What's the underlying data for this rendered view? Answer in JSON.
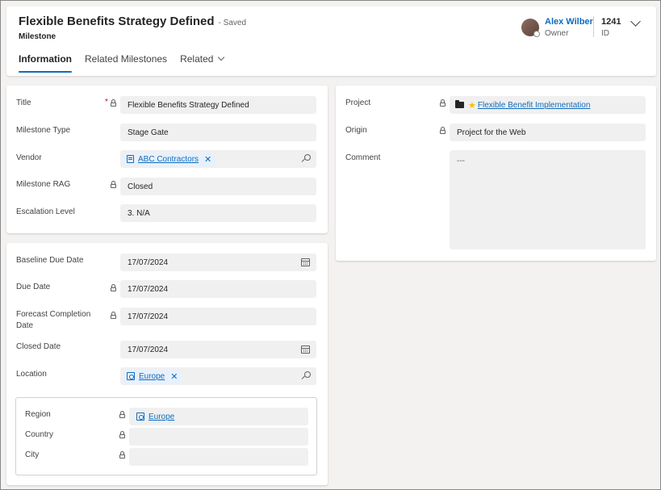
{
  "header": {
    "title": "Flexible Benefits Strategy Defined",
    "saved": "- Saved",
    "entity": "Milestone",
    "owner_name": "Alex Wilber",
    "owner_role": "Owner",
    "id_value": "1241",
    "id_label": "ID",
    "tabs": [
      {
        "label": "Information",
        "active": true
      },
      {
        "label": "Related Milestones",
        "active": false
      },
      {
        "label": "Related",
        "active": false
      }
    ]
  },
  "general": {
    "title_label": "Title",
    "title_required": "*",
    "title_value": "Flexible Benefits Strategy Defined",
    "type_label": "Milestone Type",
    "type_value": "Stage Gate",
    "vendor_label": "Vendor",
    "vendor_value": "ABC Contractors",
    "rag_label": "Milestone RAG",
    "rag_value": "Closed",
    "escalation_label": "Escalation Level",
    "escalation_value": "3. N/A"
  },
  "dates": {
    "baseline_label": "Baseline Due Date",
    "baseline_value": "17/07/2024",
    "due_label": "Due Date",
    "due_value": "17/07/2024",
    "forecast_label_1": "Forecast Completion",
    "forecast_label_2": "Date",
    "forecast_value": "17/07/2024",
    "closed_label": "Closed Date",
    "closed_value": "17/07/2024",
    "location_label": "Location",
    "location_value": "Europe"
  },
  "geo": {
    "region_label": "Region",
    "region_value": "Europe",
    "country_label": "Country",
    "country_value": "",
    "city_label": "City",
    "city_value": ""
  },
  "project": {
    "project_label": "Project",
    "project_value": "Flexible Benefit Implementation",
    "origin_label": "Origin",
    "origin_value": "Project for the Web",
    "comment_label": "Comment",
    "comment_value": "---"
  },
  "colors": {
    "accent": "#0f6cbd",
    "required": "#c50f1f",
    "field_bg": "#f0f0f0"
  }
}
